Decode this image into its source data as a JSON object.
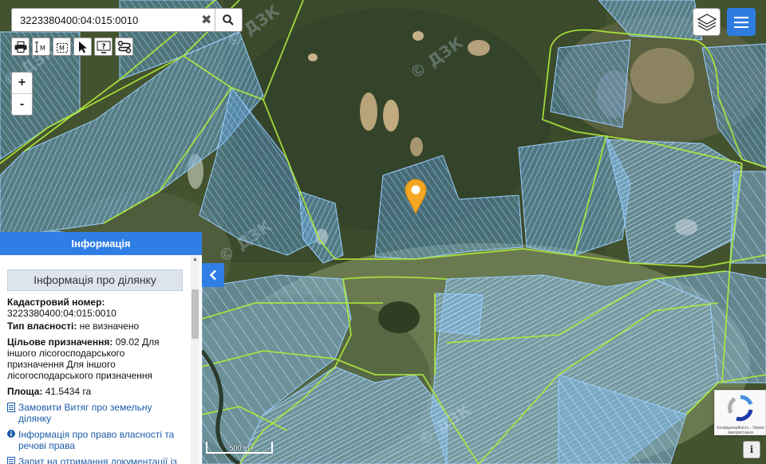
{
  "search": {
    "value": "3223380400:04:015:0010"
  },
  "icons": {
    "search": "search-icon",
    "clear": "close-icon",
    "print": "printer-icon",
    "measure_line": "measure-distance-icon",
    "measure_area": "measure-area-icon",
    "select": "cursor-icon",
    "identify": "help-icon",
    "route": "route-icon",
    "layers": "layers-icon",
    "menu": "hamburger-icon",
    "marker": "location-pin-icon"
  },
  "zoom": {
    "in": "+",
    "out": "-"
  },
  "tools": {
    "measure_line_label": "M",
    "measure_area_label": "M",
    "identify_label": "?"
  },
  "panel": {
    "title": "Інформація",
    "subtitle": "Інформація про ділянку",
    "cadastral_label": "Кадастровий номер:",
    "cadastral_value": "3223380400:04:015:0010",
    "ownership_label": "Тип власності:",
    "ownership_value": "не визначено",
    "purpose_label": "Цільове призначення:",
    "purpose_value": "09.02 Для іншого лісогосподарського призначення Для іншого лісогосподарського призначення",
    "area_label": "Площа:",
    "area_value": "41.5434 га",
    "links": [
      "Замовити Витяг про земельну ділянку",
      "Інформація про право власності та речові права",
      "Запит на отримання документації із"
    ]
  },
  "map": {
    "scale_label": "500 m",
    "watermark": "© ДЗК",
    "recaptcha_text": "Конфіденційність - Умови використання",
    "info_button": "i",
    "colors": {
      "parcel": "#7ec4ff",
      "boundary": "#aeea3a",
      "marker": "#f5a623",
      "accent": "#2f7ee6"
    }
  }
}
